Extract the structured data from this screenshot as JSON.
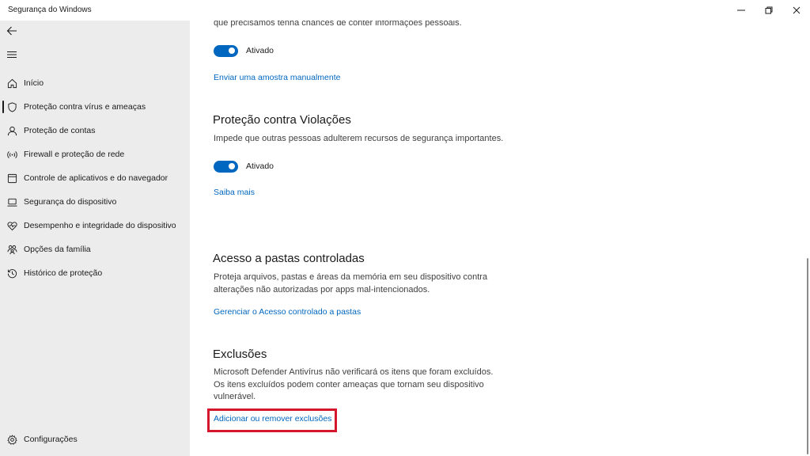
{
  "window": {
    "title": "Segurança do Windows"
  },
  "sidebar": {
    "items": [
      {
        "label": "Início",
        "icon": "home-icon"
      },
      {
        "label": "Proteção contra vírus e ameaças",
        "icon": "shield-icon",
        "active": true
      },
      {
        "label": "Proteção de contas",
        "icon": "person-icon"
      },
      {
        "label": "Firewall e proteção de rede",
        "icon": "wireless-icon"
      },
      {
        "label": "Controle de aplicativos e do navegador",
        "icon": "app-window-icon"
      },
      {
        "label": "Segurança do dispositivo",
        "icon": "laptop-icon"
      },
      {
        "label": "Desempenho e integridade do dispositivo",
        "icon": "heart-pulse-icon"
      },
      {
        "label": "Opções da família",
        "icon": "family-icon"
      },
      {
        "label": "Histórico de proteção",
        "icon": "history-icon"
      }
    ],
    "settings_label": "Configurações"
  },
  "content": {
    "sample_desc": "que precisamos tenha chances de conter informações pessoais.",
    "sample_toggle_label": "Ativado",
    "sample_link": "Enviar uma amostra manualmente",
    "tamper": {
      "title": "Proteção contra Violações",
      "desc": "Impede que outras pessoas adulterem recursos de segurança importantes.",
      "toggle_label": "Ativado",
      "link": "Saiba mais"
    },
    "folders": {
      "title": "Acesso a pastas controladas",
      "desc_line1": "Proteja arquivos, pastas e áreas da memória em seu dispositivo contra",
      "desc_line2": "alterações não autorizadas por apps mal-intencionados.",
      "link": "Gerenciar o Acesso controlado a pastas"
    },
    "exclusions": {
      "title": "Exclusões",
      "desc_line1": "Microsoft Defender Antivírus não verificará os itens que foram excluídos.",
      "desc_line2": "Os itens excluídos podem conter ameaças que tornam seu dispositivo",
      "desc_line3": "vulnerável.",
      "link": "Adicionar ou remover exclusões"
    }
  },
  "colors": {
    "accent": "#0067c0",
    "highlight": "#d5172d",
    "sidebar_bg": "#ececec"
  }
}
